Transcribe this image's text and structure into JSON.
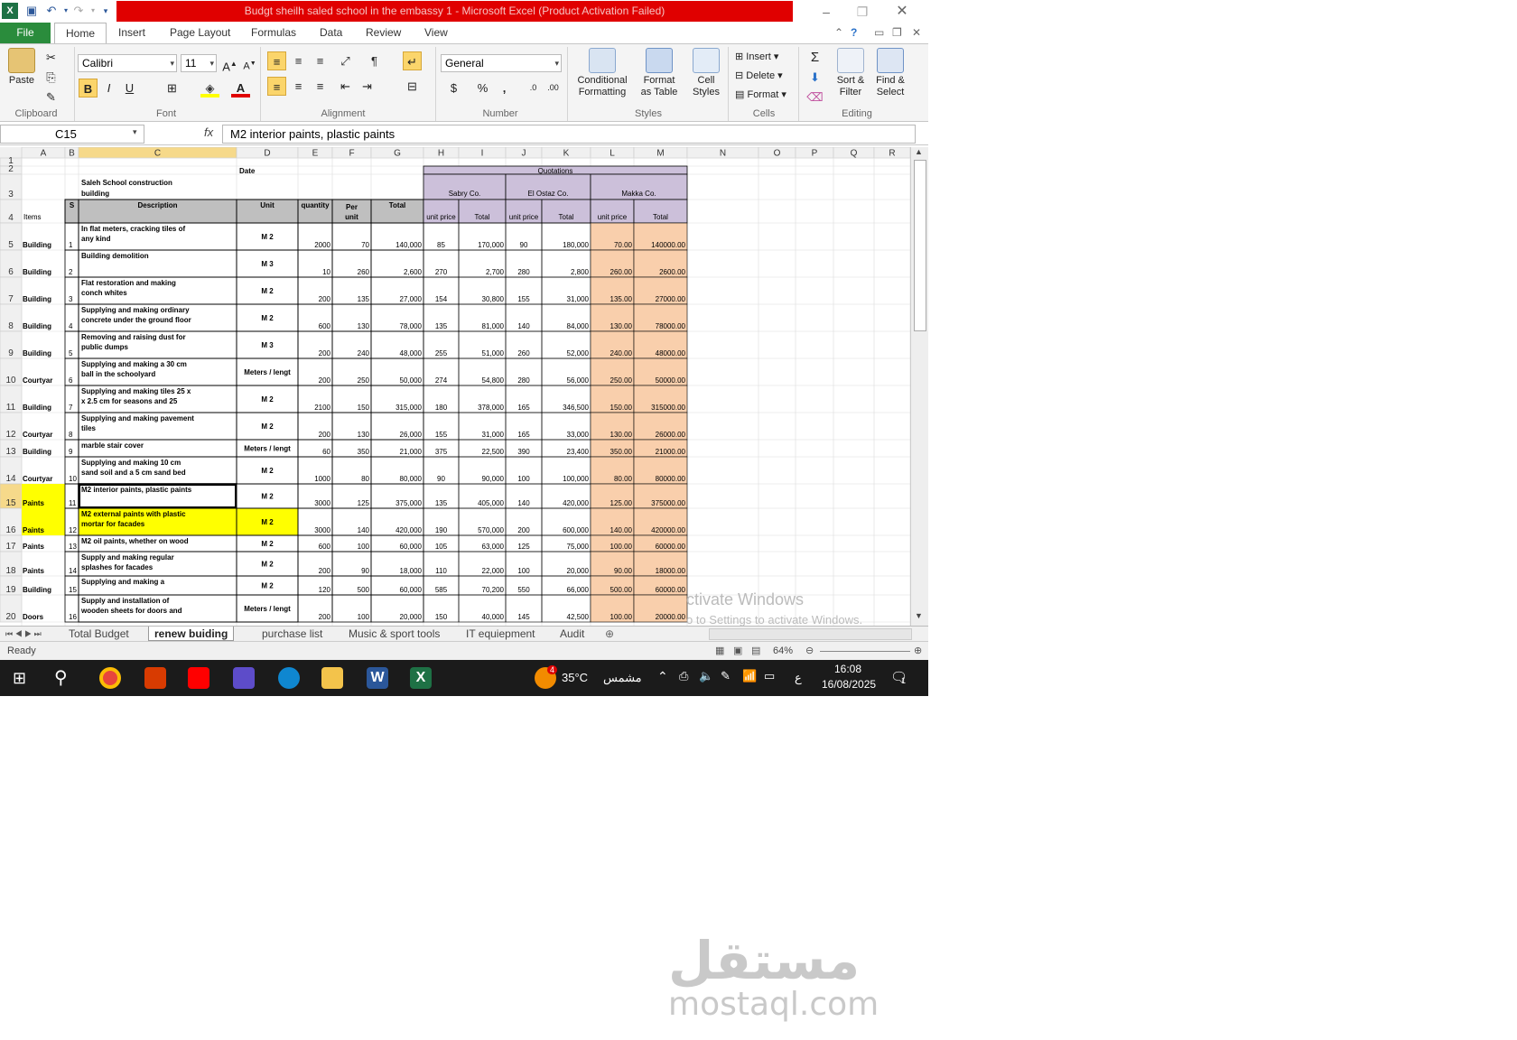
{
  "window": {
    "title": "Budgt sheilh saled school in the embassy 1  -  Microsoft Excel (Product Activation Failed)"
  },
  "ribbon_tabs": [
    "File",
    "Home",
    "Insert",
    "Page Layout",
    "Formulas",
    "Data",
    "Review",
    "View"
  ],
  "ribbon": {
    "clipboard": {
      "label": "Clipboard",
      "paste": "Paste"
    },
    "font": {
      "label": "Font",
      "name": "Calibri",
      "size": "11"
    },
    "alignment": {
      "label": "Alignment"
    },
    "number": {
      "label": "Number",
      "format": "General"
    },
    "styles": {
      "label": "Styles",
      "conditional_1": "Conditional",
      "conditional_2": "Formatting",
      "format_table_1": "Format",
      "format_table_2": "as Table",
      "cell_styles_1": "Cell",
      "cell_styles_2": "Styles"
    },
    "cells": {
      "label": "Cells",
      "insert": "Insert",
      "delete": "Delete",
      "format": "Format"
    },
    "editing": {
      "label": "Editing",
      "sort_1": "Sort &",
      "sort_2": "Filter",
      "find_1": "Find &",
      "find_2": "Select"
    }
  },
  "formula_bar": {
    "name_box": "C15",
    "fx": "fx",
    "content": "M2 interior paints, plastic paints"
  },
  "columns": [
    "A",
    "B",
    "C",
    "D",
    "E",
    "F",
    "G",
    "H",
    "I",
    "J",
    "K",
    "L",
    "M",
    "N",
    "O",
    "P",
    "Q",
    "R"
  ],
  "row_numbers": [
    "1",
    "2",
    "3",
    "4",
    "5",
    "6",
    "7",
    "8",
    "9",
    "10",
    "11",
    "12",
    "13",
    "14",
    "15",
    "16",
    "17",
    "18",
    "19",
    "20"
  ],
  "sheet": {
    "date_label": "Date",
    "project_title_1": "Saleh  School  construction",
    "project_title_2": "building",
    "quotations": "Quotations",
    "companies": [
      "Sabry Co.",
      "El Ostaz Co.",
      "Makka Co."
    ],
    "headers": {
      "items": "Items",
      "serial": "S",
      "description": "Description",
      "unit": "Unit",
      "quantity": "quantity",
      "per_unit_1": "Per",
      "per_unit_2": "unit",
      "total": "Total",
      "unit_price": "unit price",
      "sub_total": "Total"
    },
    "rows": [
      {
        "item": "Building",
        "s": "1",
        "desc1": "In flat meters, cracking tiles of",
        "desc2": "any kind",
        "unit": "M 2",
        "qty": "2000",
        "per": "70",
        "total": "140,000",
        "h": "85",
        "i": "170,000",
        "j": "90",
        "k": "180,000",
        "l": "70.00",
        "m": "140000.00"
      },
      {
        "item": "Building",
        "s": "2",
        "desc1": "Building demolition",
        "desc2": "",
        "unit": "M 3",
        "qty": "10",
        "per": "260",
        "total": "2,600",
        "h": "270",
        "i": "2,700",
        "j": "280",
        "k": "2,800",
        "l": "260.00",
        "m": "2600.00"
      },
      {
        "item": "Building",
        "s": "3",
        "desc1": "Flat restoration and making",
        "desc2": "conch whites",
        "unit": "M 2",
        "qty": "200",
        "per": "135",
        "total": "27,000",
        "h": "154",
        "i": "30,800",
        "j": "155",
        "k": "31,000",
        "l": "135.00",
        "m": "27000.00"
      },
      {
        "item": "Building",
        "s": "4",
        "desc1": "Supplying and making ordinary",
        "desc2": "concrete under the ground floor",
        "unit": "M 2",
        "qty": "600",
        "per": "130",
        "total": "78,000",
        "h": "135",
        "i": "81,000",
        "j": "140",
        "k": "84,000",
        "l": "130.00",
        "m": "78000.00"
      },
      {
        "item": "Building",
        "s": "5",
        "desc1": "Removing and raising dust for",
        "desc2": "public dumps",
        "unit": "M 3",
        "qty": "200",
        "per": "240",
        "total": "48,000",
        "h": "255",
        "i": "51,000",
        "j": "260",
        "k": "52,000",
        "l": "240.00",
        "m": "48000.00"
      },
      {
        "item": "Courtyar",
        "s": "6",
        "desc1": "Supplying and making a 30 cm",
        "desc2": "ball in the schoolyard",
        "unit": "Meters / lengt",
        "qty": "200",
        "per": "250",
        "total": "50,000",
        "h": "274",
        "i": "54,800",
        "j": "280",
        "k": "56,000",
        "l": "250.00",
        "m": "50000.00"
      },
      {
        "item": "Building",
        "s": "7",
        "desc1": "Supplying and making tiles 25 x",
        "desc2": "x 2.5 cm for seasons and 25",
        "unit": "M 2",
        "qty": "2100",
        "per": "150",
        "total": "315,000",
        "h": "180",
        "i": "378,000",
        "j": "165",
        "k": "346,500",
        "l": "150.00",
        "m": "315000.00"
      },
      {
        "item": "Courtyar",
        "s": "8",
        "desc1": "Supplying and making pavement",
        "desc2": "tiles",
        "unit": "M 2",
        "qty": "200",
        "per": "130",
        "total": "26,000",
        "h": "155",
        "i": "31,000",
        "j": "165",
        "k": "33,000",
        "l": "130.00",
        "m": "26000.00"
      },
      {
        "item": "Building",
        "s": "9",
        "desc1": "marble stair cover",
        "desc2": "",
        "unit": "Meters / lengt",
        "qty": "60",
        "per": "350",
        "total": "21,000",
        "h": "375",
        "i": "22,500",
        "j": "390",
        "k": "23,400",
        "l": "350.00",
        "m": "21000.00"
      },
      {
        "item": "Courtyar",
        "s": "10",
        "desc1": "Supplying and making 10 cm",
        "desc2": "sand soil and a 5 cm sand bed",
        "unit": "M 2",
        "qty": "1000",
        "per": "80",
        "total": "80,000",
        "h": "90",
        "i": "90,000",
        "j": "100",
        "k": "100,000",
        "l": "80.00",
        "m": "80000.00"
      },
      {
        "item": "Paints",
        "s": "11",
        "desc1": "M2 interior paints, plastic paints",
        "desc2": "",
        "unit": "M 2",
        "qty": "3000",
        "per": "125",
        "total": "375,000",
        "h": "135",
        "i": "405,000",
        "j": "140",
        "k": "420,000",
        "l": "125.00",
        "m": "375000.00"
      },
      {
        "item": "Paints",
        "s": "12",
        "desc1": "M2 external paints with plastic",
        "desc2": "mortar for facades",
        "unit": "M 2",
        "qty": "3000",
        "per": "140",
        "total": "420,000",
        "h": "190",
        "i": "570,000",
        "j": "200",
        "k": "600,000",
        "l": "140.00",
        "m": "420000.00"
      },
      {
        "item": "Paints",
        "s": "13",
        "desc1": "M2 oil paints, whether on wood",
        "desc2": "",
        "unit": "M 2",
        "qty": "600",
        "per": "100",
        "total": "60,000",
        "h": "105",
        "i": "63,000",
        "j": "125",
        "k": "75,000",
        "l": "100.00",
        "m": "60000.00"
      },
      {
        "item": "Paints",
        "s": "14",
        "desc1": "Supply and making regular",
        "desc2": "splashes for facades",
        "unit": "M 2",
        "qty": "200",
        "per": "90",
        "total": "18,000",
        "h": "110",
        "i": "22,000",
        "j": "100",
        "k": "20,000",
        "l": "90.00",
        "m": "18000.00"
      },
      {
        "item": "Building",
        "s": "15",
        "desc1": "Supplying and making a",
        "desc2": "",
        "unit": "M 2",
        "qty": "120",
        "per": "500",
        "total": "60,000",
        "h": "585",
        "i": "70,200",
        "j": "550",
        "k": "66,000",
        "l": "500.00",
        "m": "60000.00"
      },
      {
        "item": "Doors",
        "s": "16",
        "desc1": "Supply and installation of",
        "desc2": "wooden sheets for doors and",
        "unit": "Meters / lengt",
        "qty": "200",
        "per": "100",
        "total": "20,000",
        "h": "150",
        "i": "40,000",
        "j": "145",
        "k": "42,500",
        "l": "100.00",
        "m": "20000.00"
      }
    ]
  },
  "sheet_tabs": [
    "Total Budget",
    "renew buiding",
    "purchase list",
    "Music & sport tools",
    "IT equiepment",
    "Audit"
  ],
  "status": {
    "ready": "Ready",
    "zoom": "64%"
  },
  "activation": {
    "line1": "ctivate Windows",
    "line2": "o to Settings to activate Windows."
  },
  "taskbar": {
    "weather": "35°C",
    "weather_desc": "مشمس",
    "weather_badge": "4",
    "lang": "ع",
    "time": "16:08",
    "date": "16/08/2025",
    "notif": "1"
  },
  "watermark": {
    "logo": "مستقل",
    "text": "mostaql.com"
  },
  "colors": {
    "excel_green": "#2a8c3c",
    "title_red": "#e00000",
    "quotation_header": "#ccc0da",
    "makka_cells": "#f9cfac",
    "selected_row": "#ffff00",
    "header_gray": "#bfbfbf"
  }
}
